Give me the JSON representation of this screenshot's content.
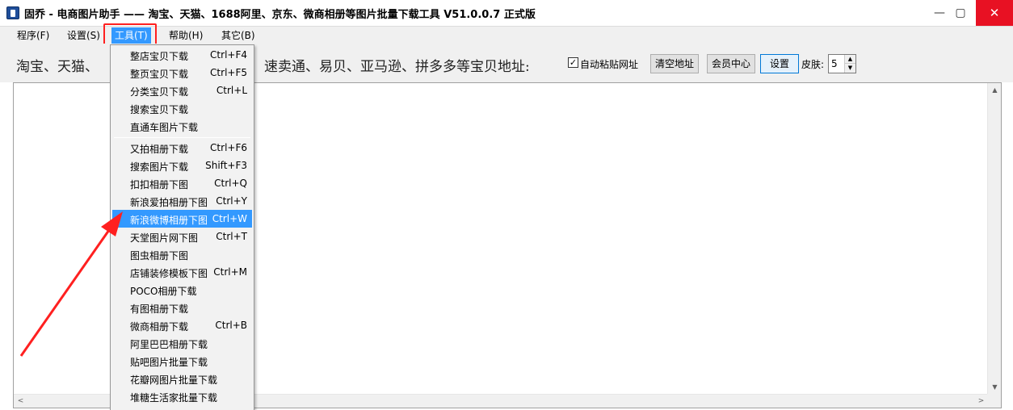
{
  "window": {
    "title": "固乔 - 电商图片助手 —— 淘宝、天猫、1688阿里、京东、微商相册等图片批量下载工具 V51.0.0.7 正式版",
    "minimize": "—",
    "maximize": "▢",
    "close": "✕"
  },
  "menubar": {
    "items": [
      {
        "label": "程序(F)"
      },
      {
        "label": "设置(S)"
      },
      {
        "label": "工具(T)"
      },
      {
        "label": "帮助(H)"
      },
      {
        "label": "其它(B)"
      }
    ]
  },
  "toolbar": {
    "label_left": "淘宝、天猫、",
    "label_right": "速卖通、易贝、亚马逊、拼多多等宝贝地址:",
    "auto_paste_checked": "✓",
    "auto_paste_label": "自动粘贴网址",
    "clear_button": "清空地址",
    "member_button": "会员中心",
    "settings_button": "设置",
    "skin_label": "皮肤:",
    "skin_value": "5",
    "spin_up": "▲",
    "spin_down": "▼"
  },
  "textarea": {
    "scroll_up": "▲",
    "scroll_down": "▼",
    "scroll_left": "<",
    "scroll_right": ">"
  },
  "dropdown": {
    "items": [
      {
        "label": "整店宝贝下载",
        "shortcut": "Ctrl+F4"
      },
      {
        "label": "整页宝贝下载",
        "shortcut": "Ctrl+F5"
      },
      {
        "label": "分类宝贝下载",
        "shortcut": "Ctrl+L"
      },
      {
        "label": "搜索宝贝下载",
        "shortcut": ""
      },
      {
        "label": "直通车图片下载",
        "shortcut": ""
      },
      {
        "label": "又拍相册下载",
        "shortcut": "Ctrl+F6"
      },
      {
        "label": "搜索图片下载",
        "shortcut": "Shift+F3"
      },
      {
        "label": "扣扣相册下图",
        "shortcut": "Ctrl+Q"
      },
      {
        "label": "新浪爱拍相册下图",
        "shortcut": "Ctrl+Y"
      },
      {
        "label": "新浪微博相册下图",
        "shortcut": "Ctrl+W"
      },
      {
        "label": "天堂图片网下图",
        "shortcut": "Ctrl+T"
      },
      {
        "label": "图虫相册下图",
        "shortcut": ""
      },
      {
        "label": "店铺装修模板下图",
        "shortcut": "Ctrl+M"
      },
      {
        "label": "POCO相册下载",
        "shortcut": ""
      },
      {
        "label": "有图相册下载",
        "shortcut": ""
      },
      {
        "label": "微商相册下载",
        "shortcut": "Ctrl+B"
      },
      {
        "label": "阿里巴巴相册下载",
        "shortcut": ""
      },
      {
        "label": "贴吧图片批量下载",
        "shortcut": ""
      },
      {
        "label": "花瓣网图片批量下载",
        "shortcut": ""
      },
      {
        "label": "堆糖生活家批量下载",
        "shortcut": ""
      }
    ]
  },
  "colors": {
    "accent": "#3399ff",
    "annotation": "#ff2020",
    "close_button": "#e81123"
  }
}
